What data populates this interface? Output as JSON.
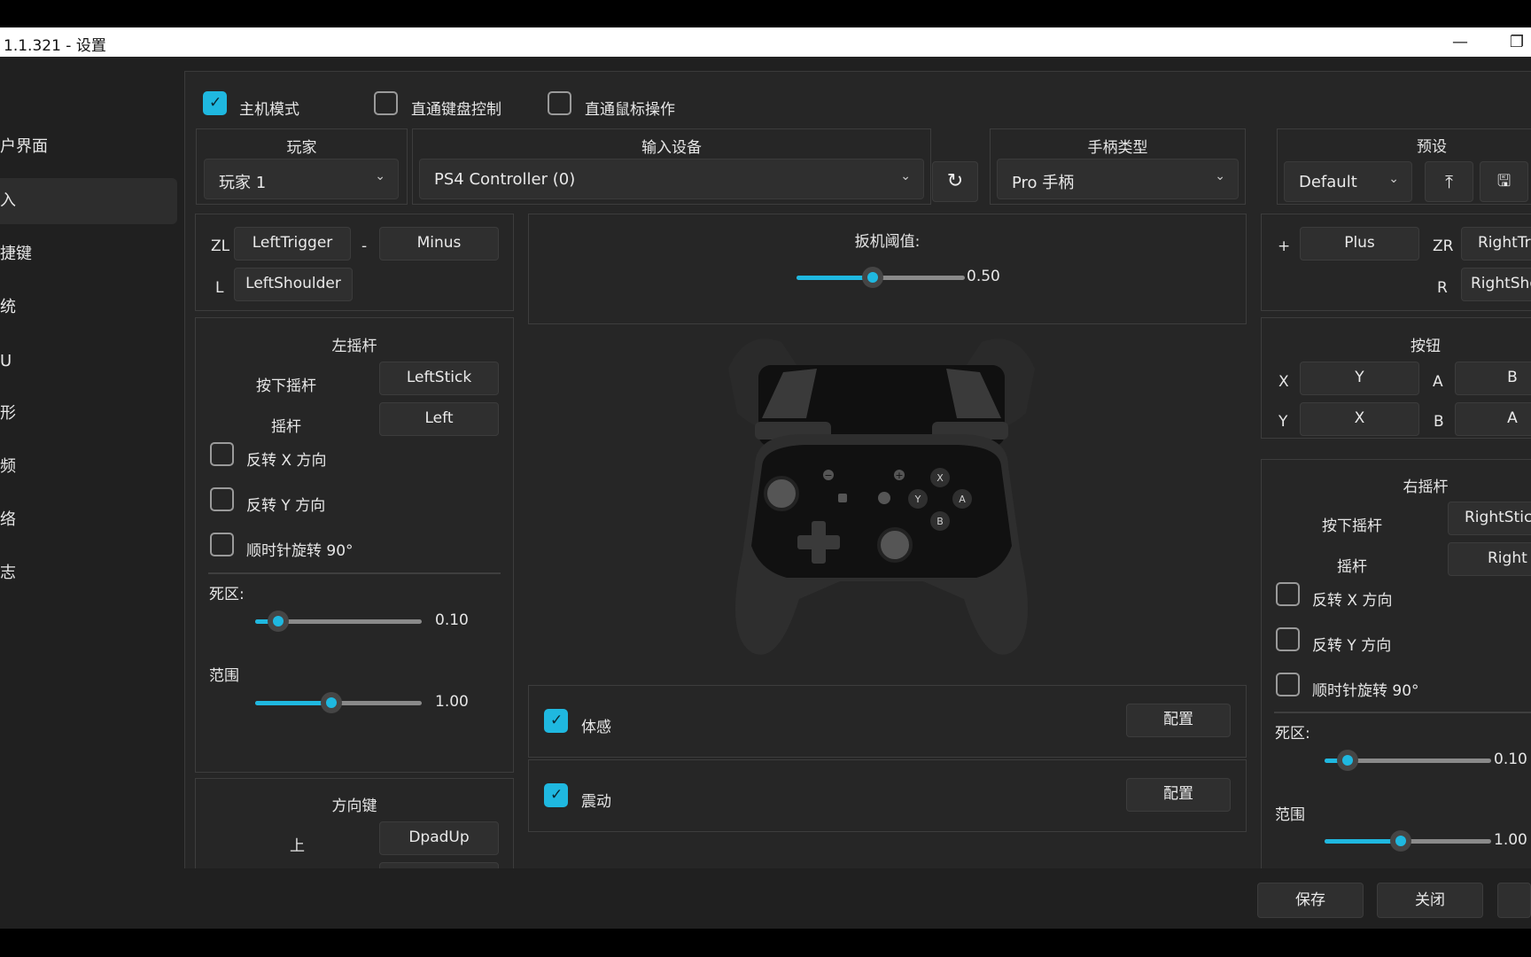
{
  "window": {
    "title": "1.1.321 - 设置",
    "minimize": "—",
    "restore": "❐"
  },
  "sidebar": {
    "items": [
      "户界面",
      "入",
      "捷键",
      "统",
      "U",
      "形",
      "频",
      "络",
      "志"
    ],
    "selected_index": 1
  },
  "top_options": {
    "host_mode": "主机模式",
    "direct_keyboard": "直通键盘控制",
    "direct_mouse": "直通鼠标操作"
  },
  "headers": {
    "player": "玩家",
    "input_device": "输入设备",
    "controller_type": "手柄类型",
    "preset": "预设"
  },
  "player": {
    "value": "玩家 1"
  },
  "input_device": {
    "value": "PS4 Controller (0)"
  },
  "controller_type": {
    "value": "Pro 手柄"
  },
  "preset": {
    "value": "Default"
  },
  "left": {
    "zl_label": "ZL",
    "zl_value": "LeftTrigger",
    "minus_label": "-",
    "minus_value": "Minus",
    "l_label": "L",
    "l_value": "LeftShoulder",
    "stick_title": "左摇杆",
    "press_stick_label": "按下摇杆",
    "press_stick_value": "LeftStick",
    "stick_label": "摇杆",
    "stick_value": "Left",
    "invert_x": "反转 X 方向",
    "invert_y": "反转 Y 方向",
    "rotate": "顺时针旋转 90°",
    "deadzone_label": "死区:",
    "deadzone_value": "0.10",
    "deadzone": 0.1,
    "range_label": "范围",
    "range_value": "1.00",
    "range": 1.0,
    "dpad_title": "方向键",
    "dpad_up_label": "上",
    "dpad_up_value": "DpadUp"
  },
  "center": {
    "trigger_threshold_label": "扳机阈值:",
    "trigger_threshold_value": "0.50",
    "trigger_threshold": 0.5,
    "motion_label": "体感",
    "motion_config": "配置",
    "rumble_label": "震动",
    "rumble_config": "配置",
    "controller_buttons": {
      "minus": "−",
      "plus": "+",
      "x": "X",
      "y": "Y",
      "a": "A",
      "b": "B"
    }
  },
  "right": {
    "plus_label": "+",
    "plus_value": "Plus",
    "zr_label": "ZR",
    "zr_value": "RightTrig",
    "r_label": "R",
    "r_value": "RightSho",
    "buttons_title": "按钮",
    "x_label": "X",
    "x_value": "Y",
    "a_label": "A",
    "a_value": "B",
    "y_label": "Y",
    "y_value": "X",
    "b_label": "B",
    "b_value": "A",
    "stick_title": "右摇杆",
    "press_stick_label": "按下摇杆",
    "press_stick_value": "RightStic",
    "stick_label": "摇杆",
    "stick_value": "Right",
    "invert_x": "反转 X 方向",
    "invert_y": "反转 Y 方向",
    "rotate": "顺时针旋转 90°",
    "deadzone_label": "死区:",
    "deadzone_value": "0.10",
    "deadzone": 0.1,
    "range_label": "范围",
    "range_value": "1.00"
  },
  "footer": {
    "save": "保存",
    "close": "关闭"
  },
  "colors": {
    "accent": "#1fb8e0",
    "background": "#202020",
    "panel": "#262626"
  }
}
